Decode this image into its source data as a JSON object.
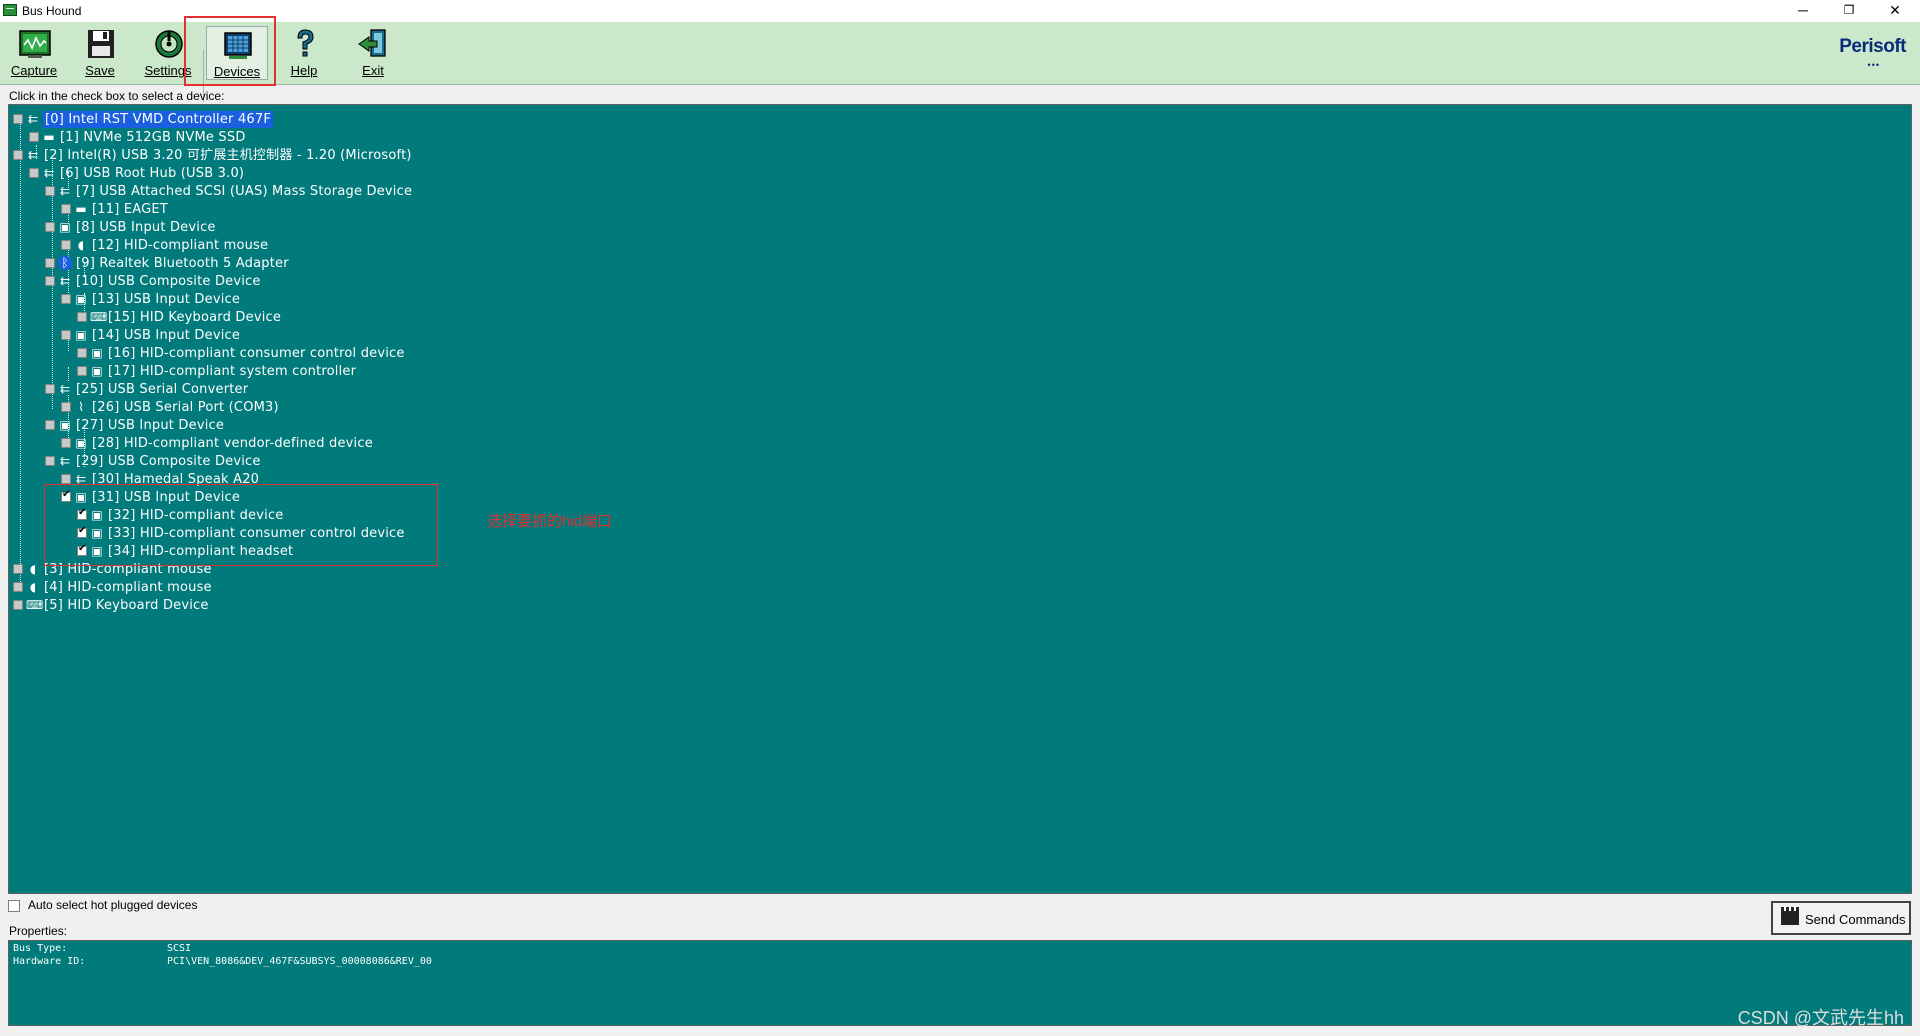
{
  "window": {
    "title": "Bus Hound",
    "minimize": "─",
    "restore": "❐",
    "close": "✕"
  },
  "toolbar": {
    "capture": "Capture",
    "save": "Save",
    "settings": "Settings",
    "devices": "Devices",
    "help": "Help",
    "exit": "Exit",
    "logo": "Perisoft",
    "logo_dots": "•••"
  },
  "hint": "Click in the check box to select a device:",
  "tree": [
    {
      "label": "[0] Intel RST VMD Controller 467F",
      "checked": false,
      "selected": true,
      "icon": "usb-icon"
    },
    {
      "label": "[1] NVMe 512GB NVMe SSD",
      "checked": false,
      "icon": "disk-icon"
    },
    {
      "label": "[2] Intel(R) USB 3.20 可扩展主机控制器 - 1.20 (Microsoft)",
      "checked": false,
      "icon": "usb-icon"
    },
    {
      "label": "[6] USB Root Hub (USB 3.0)",
      "checked": false,
      "icon": "usb-icon"
    },
    {
      "label": "[7] USB Attached SCSI (UAS) Mass Storage Device",
      "checked": false,
      "icon": "usb-icon"
    },
    {
      "label": "[11] EAGET",
      "checked": false,
      "icon": "disk-icon"
    },
    {
      "label": "[8] USB Input Device",
      "checked": false,
      "icon": "hid-icon"
    },
    {
      "label": "[12] HID-compliant mouse",
      "checked": false,
      "icon": "mouse-icon"
    },
    {
      "label": "[9] Realtek Bluetooth 5 Adapter",
      "checked": false,
      "icon": "bluetooth-icon"
    },
    {
      "label": "[10] USB Composite Device",
      "checked": false,
      "icon": "usb-icon"
    },
    {
      "label": "[13] USB Input Device",
      "checked": false,
      "icon": "hid-icon"
    },
    {
      "label": "[15] HID Keyboard Device",
      "checked": false,
      "icon": "keyboard-icon"
    },
    {
      "label": "[14] USB Input Device",
      "checked": false,
      "icon": "hid-icon"
    },
    {
      "label": "[16] HID-compliant consumer control device",
      "checked": false,
      "icon": "hid-icon"
    },
    {
      "label": "[17] HID-compliant system controller",
      "checked": false,
      "icon": "hid-icon"
    },
    {
      "label": "[25] USB Serial Converter",
      "checked": false,
      "icon": "usb-icon"
    },
    {
      "label": "[26] USB Serial Port (COM3)",
      "checked": false,
      "icon": "serial-icon"
    },
    {
      "label": "[27] USB Input Device",
      "checked": false,
      "icon": "hid-icon"
    },
    {
      "label": "[28] HID-compliant vendor-defined device",
      "checked": false,
      "icon": "hid-icon"
    },
    {
      "label": "[29] USB Composite Device",
      "checked": false,
      "icon": "usb-icon"
    },
    {
      "label": "[30] Hamedal Speak A20",
      "checked": false,
      "icon": "usb-icon"
    },
    {
      "label": "[31] USB Input Device",
      "checked": true,
      "icon": "hid-icon"
    },
    {
      "label": "[32] HID-compliant device",
      "checked": true,
      "icon": "hid-icon"
    },
    {
      "label": "[33] HID-compliant consumer control device",
      "checked": true,
      "icon": "hid-icon"
    },
    {
      "label": "[34] HID-compliant headset",
      "checked": true,
      "icon": "hid-icon"
    },
    {
      "label": "[3] HID-compliant mouse",
      "checked": false,
      "icon": "mouse-icon"
    },
    {
      "label": "[4] HID-compliant mouse",
      "checked": false,
      "icon": "mouse-icon"
    },
    {
      "label": "[5] HID Keyboard Device",
      "checked": false,
      "icon": "keyboard-icon"
    }
  ],
  "annotation": "选择要抓的hid端口",
  "auto_select": "Auto select hot plugged devices",
  "send_commands": "Send Commands",
  "properties_label": "Properties:",
  "properties": [
    {
      "key": "Bus Type:",
      "value": "SCSI"
    },
    {
      "key": "Hardware ID:",
      "value": "PCI\\VEN_8086&DEV_467F&SUBSYS_00008086&REV_00"
    }
  ],
  "watermark": "CSDN @文武先生hh"
}
